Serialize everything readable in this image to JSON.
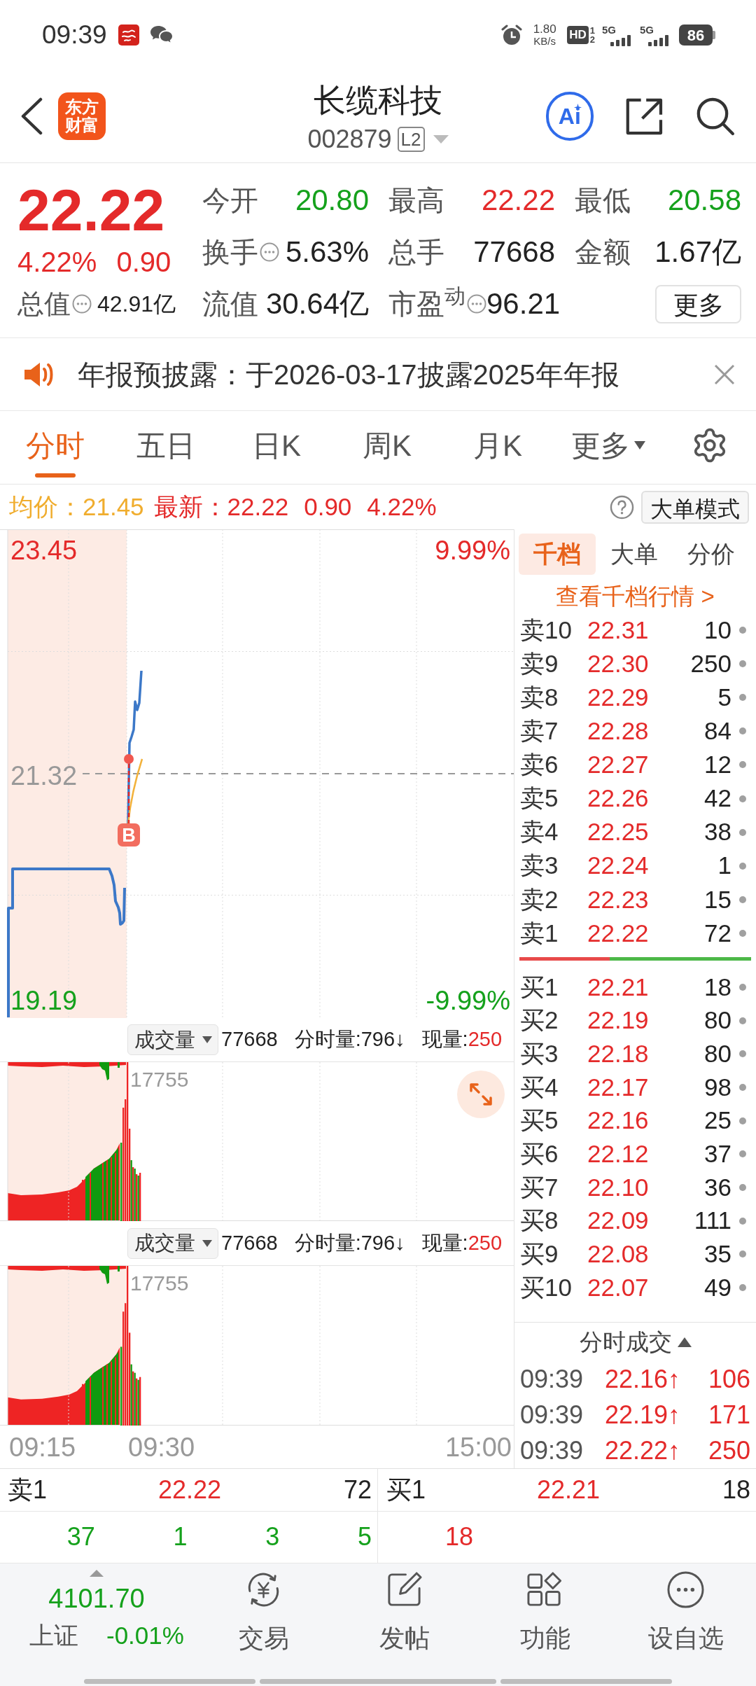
{
  "status_bar": {
    "time": "09:39",
    "speed_value": "1.80",
    "speed_unit": "KB/s",
    "hd_label": "HD",
    "sim_slots": [
      "1",
      "2"
    ],
    "networks": [
      "5G",
      "5G"
    ],
    "battery": "86"
  },
  "header": {
    "logo": [
      "东方",
      "财富"
    ],
    "title": "长缆科技",
    "code": "002879",
    "level_badge": "L2",
    "ai_label": "Ai"
  },
  "quote": {
    "price": "22.22",
    "change_pct": "4.22%",
    "change": "0.90",
    "rising": true,
    "market_value": {
      "label": "总值",
      "value": "42.91亿",
      "info": true
    },
    "stats": [
      {
        "label": "今开",
        "value": "20.80",
        "color": "#15a11c",
        "info": false
      },
      {
        "label": "最高",
        "value": "22.22",
        "color": "#e42a2a",
        "info": false
      },
      {
        "label": "最低",
        "value": "20.58",
        "color": "#15a11c",
        "info": false
      },
      {
        "label": "换手",
        "value": "5.63%",
        "color": "#222222",
        "info": true
      },
      {
        "label": "总手",
        "value": "77668",
        "color": "#222222",
        "info": false
      },
      {
        "label": "金额",
        "value": "1.67亿",
        "color": "#222222",
        "info": false
      },
      {
        "label": "流值",
        "value": "30.64亿",
        "color": "#222222",
        "info": false
      },
      {
        "label": "市盈$^{动}$",
        "value": "96.21",
        "color": "#222222",
        "info": true
      }
    ],
    "more_button": "更多"
  },
  "notice": {
    "text": "年报预披露：于2026-03-17披露2025年年报"
  },
  "chart_tabs": [
    {
      "label": "分时",
      "selected": true,
      "kind": "tab"
    },
    {
      "label": "五日",
      "selected": false,
      "kind": "tab"
    },
    {
      "label": "日K",
      "selected": false,
      "kind": "tab"
    },
    {
      "label": "周K",
      "selected": false,
      "kind": "tab"
    },
    {
      "label": "月K",
      "selected": false,
      "kind": "tab"
    },
    {
      "label": "更多",
      "selected": false,
      "kind": "menu"
    }
  ],
  "info_bar": {
    "avg": "均价：21.45",
    "latest": "最新：22.22",
    "change": "0.90",
    "change_pct": "4.22%",
    "rising": true,
    "mode_button": "大单模式"
  },
  "price_chart": {
    "price_labels": [
      {
        "text": "23.45",
        "color": "#e42a2a"
      },
      {
        "text": "21.32",
        "color": "#999999"
      },
      {
        "text": "19.19",
        "color": "#15a11c"
      }
    ],
    "percent_labels": [
      {
        "text": "9.99%",
        "color": "#e42a2a"
      },
      {
        "text": "-9.99%",
        "color": "#15a11c"
      }
    ],
    "marker": "B",
    "time_labels": [
      "09:15",
      "09:30",
      "15:00"
    ]
  },
  "volume_panels": [
    {
      "selector": "成交量",
      "total": "77668",
      "minute_volume": "分时量:796↓",
      "current_label": "现量:",
      "current_value": "250",
      "max_label": "17755",
      "expand": true
    },
    {
      "selector": "成交量",
      "total": "77668",
      "minute_volume": "分时量:796↓",
      "current_label": "现量:",
      "current_value": "250",
      "max_label": "17755",
      "expand": false
    }
  ],
  "order_book": {
    "tabs": [
      {
        "label": "千档",
        "selected": true
      },
      {
        "label": "大单",
        "selected": false
      },
      {
        "label": "分价",
        "selected": false
      }
    ],
    "link": "查看千档行情 >",
    "asks": [
      {
        "label": "卖10",
        "price": "22.31",
        "qty": "10"
      },
      {
        "label": "卖9",
        "price": "22.30",
        "qty": "250"
      },
      {
        "label": "卖8",
        "price": "22.29",
        "qty": "5"
      },
      {
        "label": "卖7",
        "price": "22.28",
        "qty": "84"
      },
      {
        "label": "卖6",
        "price": "22.27",
        "qty": "12"
      },
      {
        "label": "卖5",
        "price": "22.26",
        "qty": "42"
      },
      {
        "label": "卖4",
        "price": "22.25",
        "qty": "38"
      },
      {
        "label": "卖3",
        "price": "22.24",
        "qty": "1"
      },
      {
        "label": "卖2",
        "price": "22.23",
        "qty": "15"
      },
      {
        "label": "卖1",
        "price": "22.22",
        "qty": "72"
      }
    ],
    "ratio": {
      "level": 0.39
    },
    "bids": [
      {
        "label": "买1",
        "price": "22.21",
        "qty": "18"
      },
      {
        "label": "买2",
        "price": "22.19",
        "qty": "80"
      },
      {
        "label": "买3",
        "price": "22.18",
        "qty": "80"
      },
      {
        "label": "买4",
        "price": "22.17",
        "qty": "98"
      },
      {
        "label": "买5",
        "price": "22.16",
        "qty": "25"
      },
      {
        "label": "买6",
        "price": "22.12",
        "qty": "37"
      },
      {
        "label": "买7",
        "price": "22.10",
        "qty": "36"
      },
      {
        "label": "买8",
        "price": "22.09",
        "qty": "111"
      },
      {
        "label": "买9",
        "price": "22.08",
        "qty": "35"
      },
      {
        "label": "买10",
        "price": "22.07",
        "qty": "49"
      }
    ],
    "trades_title": "分时成交",
    "trades": [
      {
        "time": "09:39",
        "price": "22.16",
        "arrow": "↑",
        "qty": "106"
      },
      {
        "time": "09:39",
        "price": "22.19",
        "arrow": "↑",
        "qty": "171"
      },
      {
        "time": "09:39",
        "price": "22.22",
        "arrow": "↑",
        "qty": "250"
      }
    ]
  },
  "queue": {
    "ask": {
      "label": "卖1",
      "price": "22.22",
      "qty": "72",
      "orders": [
        "37",
        "1",
        "3",
        "5"
      ]
    },
    "bid": {
      "label": "买1",
      "price": "22.21",
      "qty": "18",
      "orders": [
        "18"
      ]
    }
  },
  "bottom_nav": {
    "index": {
      "value": "4101.70",
      "name": "上证",
      "change": "-0.01%",
      "rising": false
    },
    "items": [
      {
        "label": "交易",
        "kind": "trade"
      },
      {
        "label": "发帖",
        "kind": "post"
      },
      {
        "label": "功能",
        "kind": "apps"
      },
      {
        "label": "设自选",
        "kind": "watchlist"
      }
    ]
  }
}
